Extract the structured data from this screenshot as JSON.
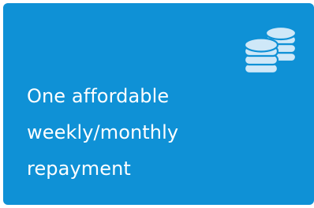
{
  "card": {
    "icon": "coins-stack-icon",
    "background_color": "#0f91d6",
    "icon_color": "#cfe8f8",
    "text_color": "#ffffff",
    "lines": [
      "One affordable",
      "weekly/monthly",
      "repayment"
    ]
  }
}
